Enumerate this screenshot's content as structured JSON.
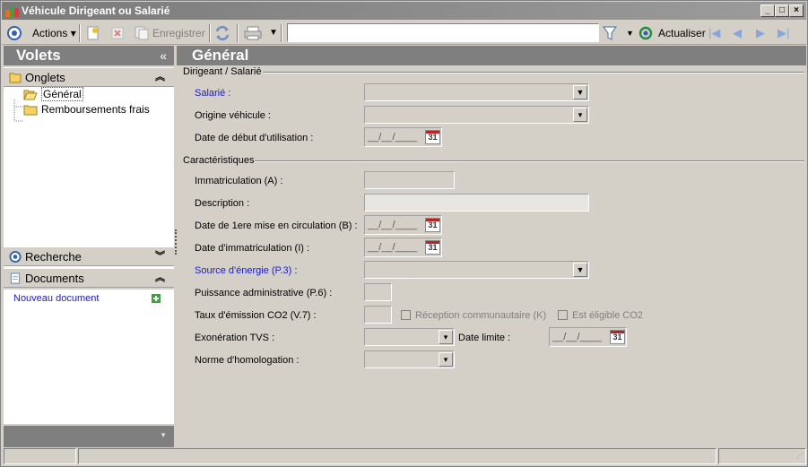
{
  "window": {
    "title": "Véhicule Dirigeant ou Salarié",
    "controls": [
      "_",
      "□",
      "×"
    ]
  },
  "toolbar": {
    "actions_label": "Actions",
    "save_label": "Enregistrer",
    "search_value": "",
    "refresh_label": "Actualiser"
  },
  "left": {
    "header": "Volets",
    "collapse_glyph": "«",
    "onglets_label": "Onglets",
    "tree": [
      "Général",
      "Remboursements frais"
    ],
    "recherche_label": "Recherche",
    "documents_label": "Documents",
    "new_doc_label": "Nouveau document"
  },
  "main": {
    "header": "Général",
    "section1": "Dirigeant / Salarié",
    "section2": "Caractéristiques",
    "labels": {
      "salarie": "Salarié :",
      "origine": "Origine véhicule :",
      "date_debut": "Date de début d'utilisation :",
      "immat": "Immatriculation (A) :",
      "description": "Description :",
      "date_mise": "Date de 1ere mise en circulation (B) :",
      "date_immat": "Date d'immatriculation (I) :",
      "source": "Source d'énergie (P.3) :",
      "puissance": "Puissance administrative (P.6) :",
      "taux": "Taux d'émission CO2 (V.7) :",
      "exoneration": "Exonération TVS :",
      "date_limite": "Date limite :",
      "norme": "Norme d'homologation :"
    },
    "checkboxes": {
      "reception": "Réception communautaire (K)",
      "eligible": "Est éligible CO2"
    },
    "date_placeholder": "__/__/____",
    "calendar_day": "31"
  },
  "colors": {
    "header_bg": "#7f7f7f",
    "required_label": "#1a1ad0",
    "window_bg": "#d4d0c8"
  }
}
